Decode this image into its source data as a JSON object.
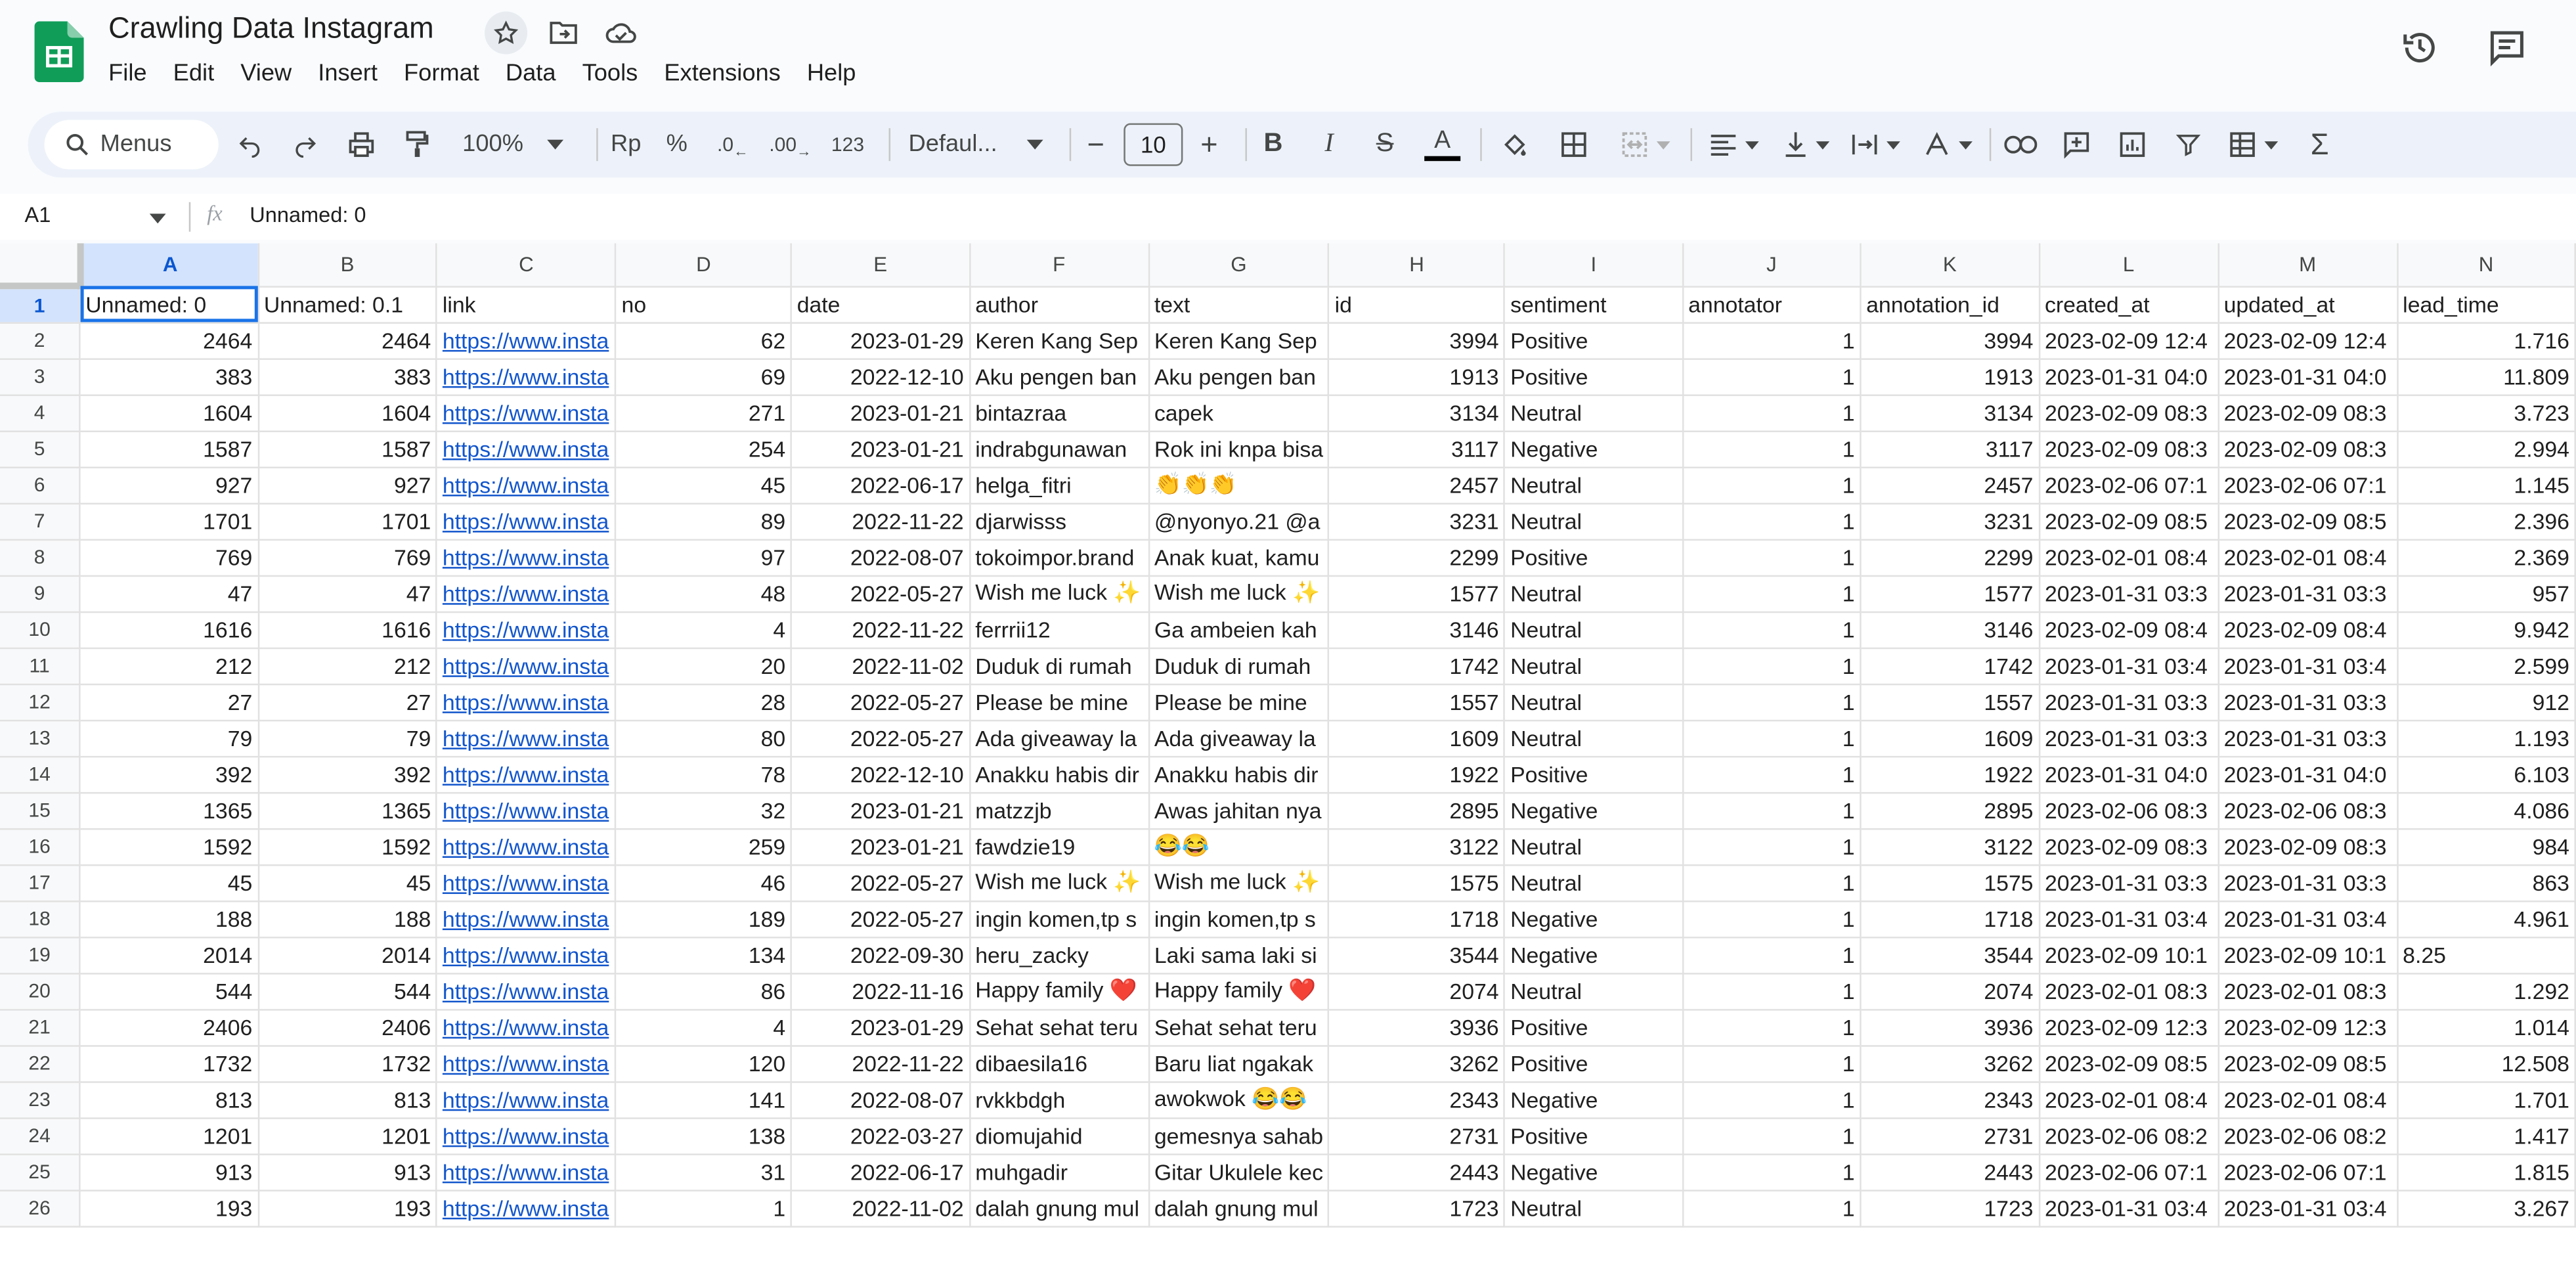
{
  "app": {
    "title": "Crawling Data Instagram",
    "menu": [
      "File",
      "Edit",
      "View",
      "Insert",
      "Format",
      "Data",
      "Tools",
      "Extensions",
      "Help"
    ]
  },
  "icons": {
    "star": "star-icon",
    "move": "folder-move-icon",
    "cloud": "cloud-saved-icon",
    "history": "history-icon",
    "comments": "comments-icon"
  },
  "toolbar": {
    "search_label": "Menus",
    "zoom": "100%",
    "currency": "Rp",
    "percent": "%",
    "dec_decrease": ".0",
    "dec_increase": ".00",
    "format_more": "123",
    "font": "Defaul...",
    "font_size": "10"
  },
  "formula_bar": {
    "cell_ref": "A1",
    "fx": "fx",
    "value": "Unnamed: 0"
  },
  "sheet": {
    "columns": [
      "A",
      "B",
      "C",
      "D",
      "E",
      "F",
      "G",
      "H",
      "I",
      "J",
      "K",
      "L",
      "M",
      "N"
    ],
    "rows": [
      [
        "Unnamed: 0",
        "Unnamed: 0.1",
        "link",
        "no",
        "date",
        "author",
        "text",
        "id",
        "sentiment",
        "annotator",
        "annotation_id",
        "created_at",
        "updated_at",
        "lead_time"
      ],
      [
        "2464",
        "2464",
        "https://www.insta",
        "62",
        "2023-01-29",
        "Keren Kang Sep",
        "Keren Kang Sep",
        "3994",
        "Positive",
        "1",
        "3994",
        "2023-02-09 12:4",
        "2023-02-09 12:4",
        "1.716"
      ],
      [
        "383",
        "383",
        "https://www.insta",
        "69",
        "2022-12-10",
        "Aku pengen ban",
        "Aku pengen ban",
        "1913",
        "Positive",
        "1",
        "1913",
        "2023-01-31 04:0",
        "2023-01-31 04:0",
        "11.809"
      ],
      [
        "1604",
        "1604",
        "https://www.insta",
        "271",
        "2023-01-21",
        "bintazraa",
        "capek",
        "3134",
        "Neutral",
        "1",
        "3134",
        "2023-02-09 08:3",
        "2023-02-09 08:3",
        "3.723"
      ],
      [
        "1587",
        "1587",
        "https://www.insta",
        "254",
        "2023-01-21",
        "indrabgunawan",
        "Rok ini knpa bisa",
        "3117",
        "Negative",
        "1",
        "3117",
        "2023-02-09 08:3",
        "2023-02-09 08:3",
        "2.994"
      ],
      [
        "927",
        "927",
        "https://www.insta",
        "45",
        "2022-06-17",
        "helga_fitri",
        "👏👏👏",
        "2457",
        "Neutral",
        "1",
        "2457",
        "2023-02-06 07:1",
        "2023-02-06 07:1",
        "1.145"
      ],
      [
        "1701",
        "1701",
        "https://www.insta",
        "89",
        "2022-11-22",
        "djarwisss",
        "@nyonyo.21 @a",
        "3231",
        "Neutral",
        "1",
        "3231",
        "2023-02-09 08:5",
        "2023-02-09 08:5",
        "2.396"
      ],
      [
        "769",
        "769",
        "https://www.insta",
        "97",
        "2022-08-07",
        "tokoimpor.brand",
        "Anak kuat, kamu",
        "2299",
        "Positive",
        "1",
        "2299",
        "2023-02-01 08:4",
        "2023-02-01 08:4",
        "2.369"
      ],
      [
        "47",
        "47",
        "https://www.insta",
        "48",
        "2022-05-27",
        "Wish me luck ✨",
        "Wish me luck ✨",
        "1577",
        "Neutral",
        "1",
        "1577",
        "2023-01-31 03:3",
        "2023-01-31 03:3",
        "957"
      ],
      [
        "1616",
        "1616",
        "https://www.insta",
        "4",
        "2022-11-22",
        "ferrrii12",
        "Ga ambeien kah",
        "3146",
        "Neutral",
        "1",
        "3146",
        "2023-02-09 08:4",
        "2023-02-09 08:4",
        "9.942"
      ],
      [
        "212",
        "212",
        "https://www.insta",
        "20",
        "2022-11-02",
        "Duduk di rumah",
        "Duduk di rumah",
        "1742",
        "Neutral",
        "1",
        "1742",
        "2023-01-31 03:4",
        "2023-01-31 03:4",
        "2.599"
      ],
      [
        "27",
        "27",
        "https://www.insta",
        "28",
        "2022-05-27",
        "Please be mine",
        "Please be mine",
        "1557",
        "Neutral",
        "1",
        "1557",
        "2023-01-31 03:3",
        "2023-01-31 03:3",
        "912"
      ],
      [
        "79",
        "79",
        "https://www.insta",
        "80",
        "2022-05-27",
        "Ada giveaway la",
        "Ada giveaway la",
        "1609",
        "Neutral",
        "1",
        "1609",
        "2023-01-31 03:3",
        "2023-01-31 03:3",
        "1.193"
      ],
      [
        "392",
        "392",
        "https://www.insta",
        "78",
        "2022-12-10",
        "Anakku habis dir",
        "Anakku habis dir",
        "1922",
        "Positive",
        "1",
        "1922",
        "2023-01-31 04:0",
        "2023-01-31 04:0",
        "6.103"
      ],
      [
        "1365",
        "1365",
        "https://www.insta",
        "32",
        "2023-01-21",
        "matzzjb",
        "Awas jahitan nya",
        "2895",
        "Negative",
        "1",
        "2895",
        "2023-02-06 08:3",
        "2023-02-06 08:3",
        "4.086"
      ],
      [
        "1592",
        "1592",
        "https://www.insta",
        "259",
        "2023-01-21",
        "fawdzie19",
        "😂😂",
        "3122",
        "Neutral",
        "1",
        "3122",
        "2023-02-09 08:3",
        "2023-02-09 08:3",
        "984"
      ],
      [
        "45",
        "45",
        "https://www.insta",
        "46",
        "2022-05-27",
        "Wish me luck ✨",
        "Wish me luck ✨",
        "1575",
        "Neutral",
        "1",
        "1575",
        "2023-01-31 03:3",
        "2023-01-31 03:3",
        "863"
      ],
      [
        "188",
        "188",
        "https://www.insta",
        "189",
        "2022-05-27",
        "ingin komen,tp s",
        "ingin komen,tp s",
        "1718",
        "Negative",
        "1",
        "1718",
        "2023-01-31 03:4",
        "2023-01-31 03:4",
        "4.961"
      ],
      [
        "2014",
        "2014",
        "https://www.insta",
        "134",
        "2022-09-30",
        "heru_zacky",
        "Laki sama laki si",
        "3544",
        "Negative",
        "1",
        "3544",
        "2023-02-09 10:1",
        "2023-02-09 10:1",
        "8.25"
      ],
      [
        "544",
        "544",
        "https://www.insta",
        "86",
        "2022-11-16",
        "Happy family ❤️",
        "Happy family ❤️",
        "2074",
        "Neutral",
        "1",
        "2074",
        "2023-02-01 08:3",
        "2023-02-01 08:3",
        "1.292"
      ],
      [
        "2406",
        "2406",
        "https://www.insta",
        "4",
        "2023-01-29",
        "Sehat sehat teru",
        "Sehat sehat teru",
        "3936",
        "Positive",
        "1",
        "3936",
        "2023-02-09 12:3",
        "2023-02-09 12:3",
        "1.014"
      ],
      [
        "1732",
        "1732",
        "https://www.insta",
        "120",
        "2022-11-22",
        "dibaesila16",
        "Baru liat ngakak",
        "3262",
        "Positive",
        "1",
        "3262",
        "2023-02-09 08:5",
        "2023-02-09 08:5",
        "12.508"
      ],
      [
        "813",
        "813",
        "https://www.insta",
        "141",
        "2022-08-07",
        "rvkkbdgh",
        "awokwok 😂😂",
        "2343",
        "Negative",
        "1",
        "2343",
        "2023-02-01 08:4",
        "2023-02-01 08:4",
        "1.701"
      ],
      [
        "1201",
        "1201",
        "https://www.insta",
        "138",
        "2022-03-27",
        "diomujahid",
        "gemesnya sahab",
        "2731",
        "Positive",
        "1",
        "2731",
        "2023-02-06 08:2",
        "2023-02-06 08:2",
        "1.417"
      ],
      [
        "913",
        "913",
        "https://www.insta",
        "31",
        "2022-06-17",
        "muhgadir",
        "Gitar Ukulele kec",
        "2443",
        "Negative",
        "1",
        "2443",
        "2023-02-06 07:1",
        "2023-02-06 07:1",
        "1.815"
      ],
      [
        "193",
        "193",
        "https://www.insta",
        "1",
        "2022-11-02",
        "dalah gnung mul",
        "dalah gnung mul",
        "1723",
        "Neutral",
        "1",
        "1723",
        "2023-01-31 03:4",
        "2023-01-31 03:4",
        "3.267"
      ]
    ],
    "left_text_rows": [
      19
    ]
  }
}
